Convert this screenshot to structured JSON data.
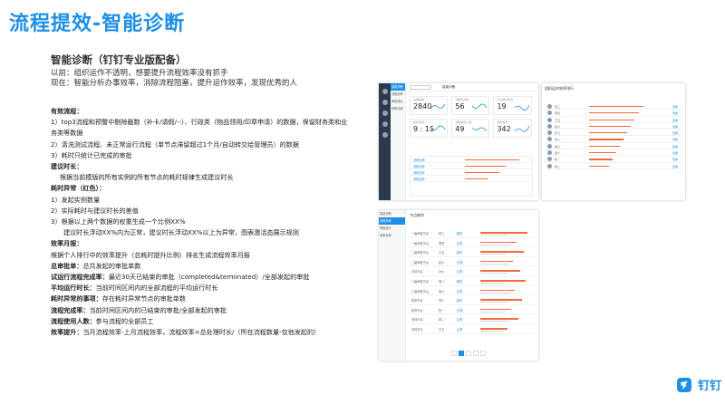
{
  "title": "流程提效-智能诊断",
  "subtitle": "智能诊断（钉钉专业版配备）",
  "intro": {
    "before": "以前：组织运作不透明，想要提升流程效率没有抓手",
    "now": "现在：智能分析办事效率，消除流程阻塞，提升运作效率，发现优秀的人"
  },
  "sections": {
    "efficiency_heading": "有效流程：",
    "efficiency_1": "1）top3流程和预警中剔除截数（补卡/请假/--）、行政类（物品领用/印章申请）的数据，保留财务类和业",
    "efficiency_1b": "务类等数据",
    "efficiency_2": "2）清洗测试流程、未正常运行流程（单节点滞留超过1个月/自动转交给管理员）的数据",
    "efficiency_3": "3）耗时只统计已完成的审批",
    "suggest_heading": "建议时长：",
    "suggest_1": "根据当前模版的所有实例的所有节点的耗时规律生成建议时长",
    "abnormal_heading": "耗时异常（红色）：",
    "abnormal_1": "1）发起实例数量",
    "abnormal_2": "2）实际耗时与建议时长的差值",
    "abnormal_3": "3）根据以上两个数据的权重生成一个比例XX%",
    "abnormal_4": "建议时长浮动XX%内为正常，建议时长浮动XX%以上为异常，图表激活态展示规则",
    "monthly_heading": "效率月报：",
    "monthly_1": "根据个人排行中的效率提升（总耗时提升比例）排名生成流程效率月报",
    "total_label": "总审批单：",
    "total_text": "总共发起的审批单数",
    "active_label": "试运行流程完成率：",
    "active_text": "最近30天已结束的审批（completed&terminated）/全部发起的审批",
    "avg_label": "平均运行时长：",
    "avg_text": "当前时间区间内的全部流程的平均运行时长",
    "abn_count_label": "耗时异常的事项：",
    "abn_count_text": "存在耗时异常节点的审批单数",
    "complete_label": "流程完成率：",
    "complete_text": "当前时间区间内的已结束的审批/全部发起的审批",
    "users_label": "流程使用人数：",
    "users_text": "参与流程的全部员工",
    "rate_label": "效率提升：",
    "rate_text": "当月流程效率-上月流程效率，流程效率=总处理时长/（所在流程数量-仅他发起的）"
  },
  "shot1": {
    "topbar_title": "智能诊断",
    "menu": [
      "智能诊断",
      "流程效率",
      "审批统计",
      "效率月报"
    ],
    "stats": [
      {
        "label": "总审批单",
        "value": "2840"
      },
      {
        "label": "流程完成率",
        "value": "56"
      },
      {
        "label": "平均运行时长",
        "value": "19"
      },
      {
        "label": "耗时异常",
        "value": "9 : 15"
      },
      {
        "label": "流程使用人数",
        "value": "49"
      },
      {
        "label": "效率提升",
        "value": "342"
      }
    ],
    "rows": [
      "流程名称",
      "流程名称",
      "流程名称",
      "流程名称"
    ]
  },
  "shot2": {
    "title": "组织运作效率排行",
    "rows": [
      "张三",
      "李四",
      "王五",
      "赵六",
      "孙七",
      "周八",
      "吴九",
      "郑十",
      "陈一",
      "林二"
    ],
    "link": "查看"
  },
  "shot3": {
    "title": "节点耗时",
    "menu": [
      "智能诊断",
      "流程效率",
      "审批统计",
      "效率月报"
    ],
    "rows": [
      {
        "name": "一级审批节点",
        "who": "张三",
        "status": "超时"
      },
      {
        "name": "一级审批节点",
        "who": "李四",
        "status": "正常"
      },
      {
        "name": "二级审批节点",
        "who": "王五",
        "status": "超时"
      },
      {
        "name": "二级审批节点",
        "who": "赵六",
        "status": "正常"
      },
      {
        "name": "抄送节点",
        "who": "孙七",
        "status": "正常"
      },
      {
        "name": "三级审批节点",
        "who": "周八",
        "status": "超时"
      },
      {
        "name": "三级审批节点",
        "who": "吴九",
        "status": "正常"
      },
      {
        "name": "财务节点",
        "who": "郑十",
        "status": "超时"
      },
      {
        "name": "财务节点",
        "who": "陈一",
        "status": "正常"
      },
      {
        "name": "归档节点",
        "who": "林二",
        "status": "正常"
      },
      {
        "name": "归档节点",
        "who": "王五",
        "status": "正常"
      }
    ]
  },
  "logo_text": "钉钉",
  "colors": {
    "accent": "#1e8fe8",
    "warning": "#f26b3a",
    "rail": "#2d3a4b"
  }
}
